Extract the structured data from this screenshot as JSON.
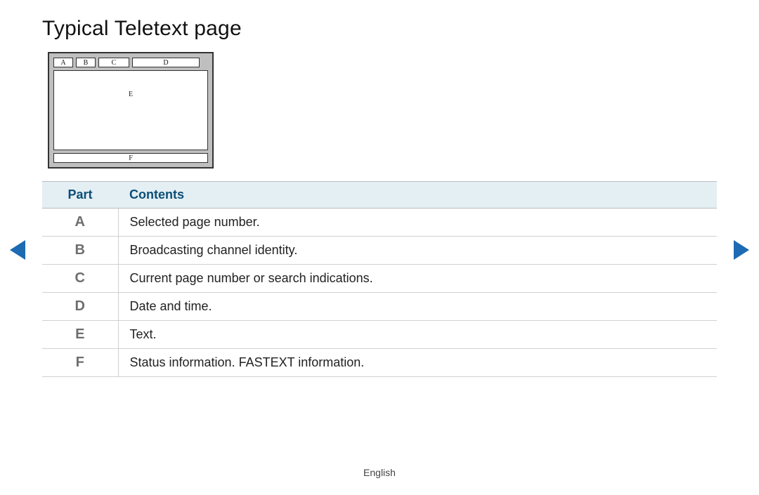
{
  "title": "Typical Teletext page",
  "diagram": {
    "a": "A",
    "b": "B",
    "c": "C",
    "d": "D",
    "e": "E",
    "f": "F"
  },
  "table": {
    "headers": {
      "part": "Part",
      "contents": "Contents"
    },
    "rows": [
      {
        "part": "A",
        "contents": "Selected page number."
      },
      {
        "part": "B",
        "contents": "Broadcasting channel identity."
      },
      {
        "part": "C",
        "contents": "Current page number or search indications."
      },
      {
        "part": "D",
        "contents": "Date and time."
      },
      {
        "part": "E",
        "contents": "Text."
      },
      {
        "part": "F",
        "contents": "Status information. FASTEXT information."
      }
    ]
  },
  "footer": "English"
}
